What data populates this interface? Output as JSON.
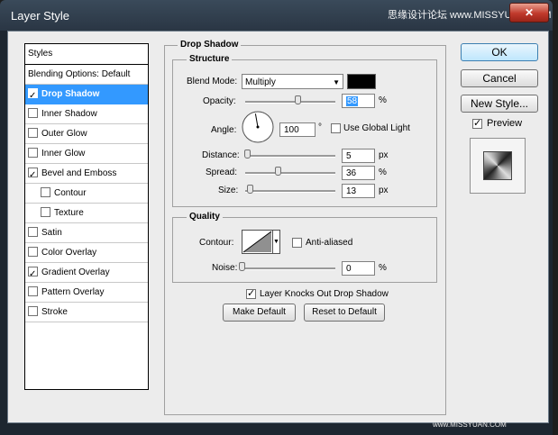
{
  "window": {
    "title": "Layer Style",
    "watermark": "思缘设计论坛 www.MISSYUAN.COM",
    "watermark_bottom": "www.MISSYUAN.COM"
  },
  "styles_list": {
    "header": "Styles",
    "blending": "Blending Options: Default",
    "items": [
      {
        "label": "Drop Shadow",
        "checked": true,
        "selected": true,
        "sub": false
      },
      {
        "label": "Inner Shadow",
        "checked": false,
        "selected": false,
        "sub": false
      },
      {
        "label": "Outer Glow",
        "checked": false,
        "selected": false,
        "sub": false
      },
      {
        "label": "Inner Glow",
        "checked": false,
        "selected": false,
        "sub": false
      },
      {
        "label": "Bevel and Emboss",
        "checked": true,
        "selected": false,
        "sub": false
      },
      {
        "label": "Contour",
        "checked": false,
        "selected": false,
        "sub": true
      },
      {
        "label": "Texture",
        "checked": false,
        "selected": false,
        "sub": true
      },
      {
        "label": "Satin",
        "checked": false,
        "selected": false,
        "sub": false
      },
      {
        "label": "Color Overlay",
        "checked": false,
        "selected": false,
        "sub": false
      },
      {
        "label": "Gradient Overlay",
        "checked": true,
        "selected": false,
        "sub": false
      },
      {
        "label": "Pattern Overlay",
        "checked": false,
        "selected": false,
        "sub": false
      },
      {
        "label": "Stroke",
        "checked": false,
        "selected": false,
        "sub": false
      }
    ]
  },
  "drop_shadow": {
    "title": "Drop Shadow",
    "structure": {
      "title": "Structure",
      "blend_mode_label": "Blend Mode:",
      "blend_mode_value": "Multiply",
      "shadow_color": "#000000",
      "opacity_label": "Opacity:",
      "opacity_value": "58",
      "opacity_unit": "%",
      "opacity_fraction": 0.58,
      "angle_label": "Angle:",
      "angle_value": "100",
      "angle_unit": "°",
      "use_global_light_label": "Use Global Light",
      "use_global_light": false,
      "distance_label": "Distance:",
      "distance_value": "5",
      "distance_unit": "px",
      "distance_fraction": 0.02,
      "spread_label": "Spread:",
      "spread_value": "36",
      "spread_unit": "%",
      "spread_fraction": 0.36,
      "size_label": "Size:",
      "size_value": "13",
      "size_unit": "px",
      "size_fraction": 0.05
    },
    "quality": {
      "title": "Quality",
      "contour_label": "Contour:",
      "anti_aliased_label": "Anti-aliased",
      "anti_aliased": false,
      "noise_label": "Noise:",
      "noise_value": "0",
      "noise_unit": "%",
      "noise_fraction": 0.0
    },
    "layer_knocks_out_label": "Layer Knocks Out Drop Shadow",
    "layer_knocks_out": true,
    "make_default_label": "Make Default",
    "reset_default_label": "Reset to Default"
  },
  "buttons": {
    "ok": "OK",
    "cancel": "Cancel",
    "new_style": "New Style...",
    "preview_label": "Preview",
    "preview": true
  }
}
